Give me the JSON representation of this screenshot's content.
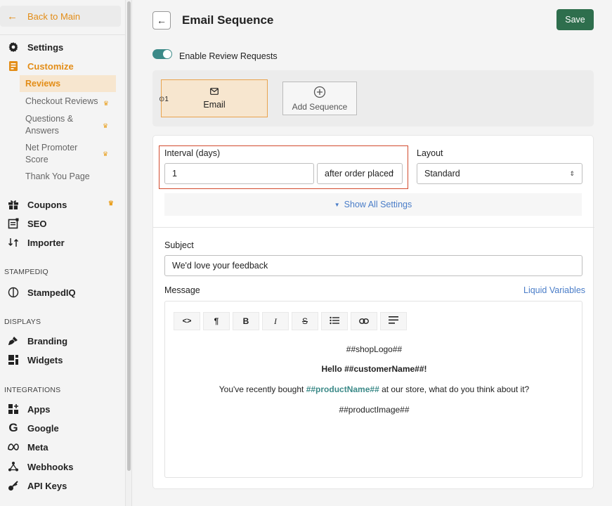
{
  "sidebar": {
    "back_label": "Back to Main",
    "settings_label": "Settings",
    "customize_label": "Customize",
    "sub_items": [
      "Reviews",
      "Checkout Reviews",
      "Questions & Answers",
      "Net Promoter Score",
      "Thank You Page"
    ],
    "coupons_label": "Coupons",
    "seo_label": "SEO",
    "importer_label": "Importer",
    "section_stampediq": "STAMPEDIQ",
    "stampediq_label": "StampedIQ",
    "section_displays": "DISPLAYS",
    "branding_label": "Branding",
    "widgets_label": "Widgets",
    "section_integrations": "INTEGRATIONS",
    "apps_label": "Apps",
    "google_label": "Google",
    "meta_label": "Meta",
    "webhooks_label": "Webhooks",
    "apikeys_label": "API Keys"
  },
  "header": {
    "title": "Email Sequence",
    "save_label": "Save"
  },
  "toggle": {
    "label": "Enable Review Requests",
    "enabled": true
  },
  "sequence": {
    "step_number": "1",
    "email_label": "Email",
    "add_label": "Add Sequence"
  },
  "form": {
    "interval_label": "Interval (days)",
    "interval_value": "1",
    "interval_trigger": "after order placed",
    "layout_label": "Layout",
    "layout_value": "Standard",
    "show_all": "Show All Settings",
    "subject_label": "Subject",
    "subject_value": "We'd love your feedback",
    "message_label": "Message",
    "liquid_link": "Liquid Variables"
  },
  "editor": {
    "toolbar": [
      "<>",
      "¶",
      "B",
      "I",
      "S",
      "list",
      "link",
      "align"
    ],
    "shop_logo": "##shopLogo##",
    "greeting": "Hello ##customerName##!",
    "body_pre": "You've recently bought",
    "body_var": "##productName##",
    "body_post": "at our store, what do you think about it?",
    "product_image": "##productImage##"
  },
  "colors": {
    "accent_orange": "#e38d17",
    "save_green": "#2e6e4d",
    "toggle_teal": "#3c8a88",
    "highlight_red": "#d24b2e",
    "link_blue": "#4a7dc8"
  }
}
